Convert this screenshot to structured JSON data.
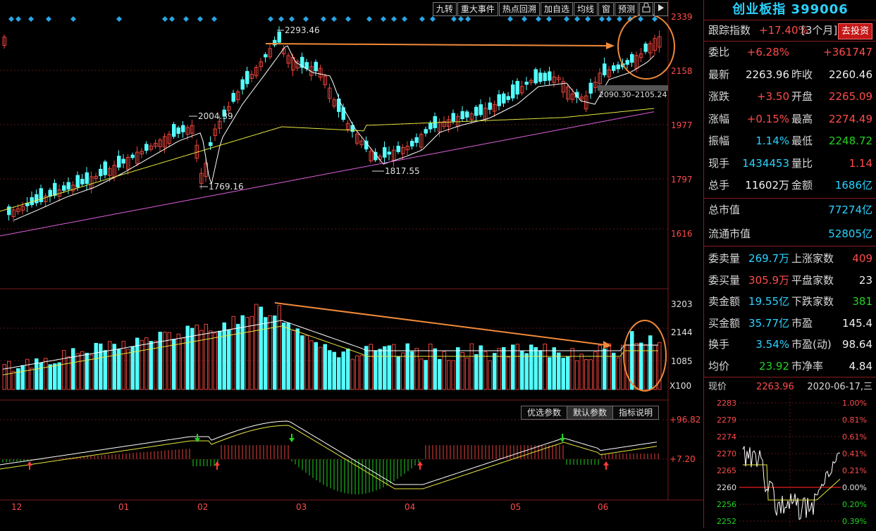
{
  "toolbar": {
    "buttons": [
      "九转",
      "重大事件",
      "热点回溯",
      "加自选",
      "均线",
      "窗",
      "预测"
    ]
  },
  "price_axis": [
    "2339",
    "2158",
    "1977",
    "1797",
    "1616"
  ],
  "volume_axis": [
    "3203",
    "2144",
    "1085",
    "X100"
  ],
  "macd_axis": [
    "+96.82",
    "+7.20"
  ],
  "macd_tabs": [
    "优选参数",
    "默认参数",
    "指标说明"
  ],
  "x_axis": [
    "12",
    "01",
    "02",
    "03",
    "04",
    "05",
    "06"
  ],
  "annotations": {
    "high": "2293.46",
    "low1": "1769.16",
    "mid": "2004.39",
    "low2": "1817.55",
    "range": "2090.30–2105.24"
  },
  "panel": {
    "title": "创业板指 399006",
    "track_label": "跟踪指数",
    "track_value": "+17.40%",
    "track_period": "[3个月]",
    "invest_button": "去投资",
    "rows": [
      {
        "l1": "委比",
        "v1": "+6.28%",
        "c1": "red",
        "l2": "",
        "v2": "+361747",
        "c2": "red"
      },
      {
        "l1": "最新",
        "v1": "2263.96",
        "c1": "white",
        "l2": "昨收",
        "v2": "2260.46",
        "c2": "white"
      },
      {
        "l1": "涨跌",
        "v1": "+3.50",
        "c1": "red",
        "l2": "开盘",
        "v2": "2265.09",
        "c2": "red"
      },
      {
        "l1": "涨幅",
        "v1": "+0.15%",
        "c1": "red",
        "l2": "最高",
        "v2": "2274.49",
        "c2": "red"
      },
      {
        "l1": "振幅",
        "v1": "1.14%",
        "c1": "cyan",
        "l2": "最低",
        "v2": "2248.72",
        "c2": "green"
      },
      {
        "l1": "现手",
        "v1": "1434453",
        "c1": "cyan",
        "l2": "量比",
        "v2": "1.14",
        "c2": "red"
      },
      {
        "l1": "总手",
        "v1": "11602万",
        "c1": "white",
        "l2": "金额",
        "v2": "1686亿",
        "c2": "cyan"
      }
    ],
    "mktcap_label": "总市值",
    "mktcap_value": "77274亿",
    "float_label": "流通市值",
    "float_value": "52805亿",
    "rows2": [
      {
        "l1": "委卖量",
        "v1": "269.7万",
        "c1": "cyan",
        "l2": "上涨家数",
        "v2": "409",
        "c2": "red"
      },
      {
        "l1": "委买量",
        "v1": "305.9万",
        "c1": "red",
        "l2": "平盘家数",
        "v2": "23",
        "c2": "white"
      },
      {
        "l1": "卖金额",
        "v1": "19.55亿",
        "c1": "cyan",
        "l2": "下跌家数",
        "v2": "381",
        "c2": "green"
      },
      {
        "l1": "买金额",
        "v1": "35.77亿",
        "c1": "cyan",
        "l2": "市盈",
        "v2": "145.4",
        "c2": "white"
      },
      {
        "l1": "换手",
        "v1": "3.54%",
        "c1": "cyan",
        "l2": "市盈(动)",
        "v2": "98.64",
        "c2": "white"
      },
      {
        "l1": "均价",
        "v1": "23.92",
        "c1": "green",
        "l2": "市净率",
        "v2": "4.84",
        "c2": "white"
      }
    ],
    "now_label": "现价",
    "now_value": "2263.96",
    "now_date": "2020-06-17,三",
    "mini_left": [
      "2283",
      "2279",
      "2274",
      "2270",
      "2265",
      "2260",
      "2256",
      "2252"
    ],
    "mini_right": [
      "1.00%",
      "0.81%",
      "0.61%",
      "0.41%",
      "0.21%",
      "0.00%",
      "0.20%",
      "0.39%"
    ]
  },
  "colors": {
    "up": "#e8433b",
    "down": "#54ffff",
    "accent": "#f08a3a",
    "ma_white": "#ffffff",
    "ma_yellow": "#e6e640",
    "ma_pink": "#d95fd9"
  }
}
